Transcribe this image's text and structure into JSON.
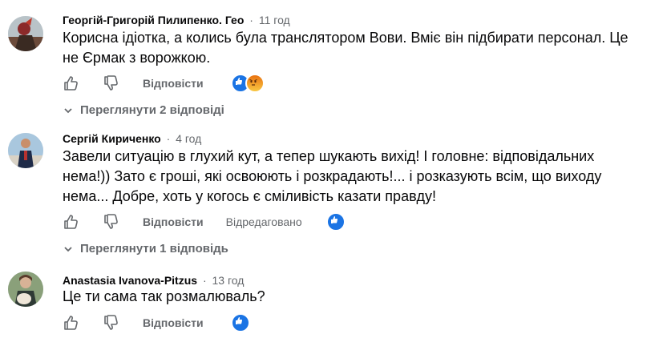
{
  "common": {
    "reply_label": "Відповісти",
    "like_icon": "thumbs-up-outline-icon",
    "dislike_icon": "thumbs-down-outline-icon",
    "accent": "#1b74e4",
    "muted": "#65686c"
  },
  "comments": [
    {
      "author": "Георгій-Григорій Пилипенко. Гео",
      "time": "11 год",
      "text_line1": "Корисна ідіотка, а колись була транслятором Вови. Вміє він підбирати персонал. Це",
      "text_line2": "не Єрмак з ворожкою.",
      "reactions": [
        "like",
        "angry"
      ],
      "replies_label": "Переглянути 2 відповіді"
    },
    {
      "author": "Сергій Кириченко",
      "time": "4 год",
      "text_line1": "Завели ситуацію в глухий кут, а тепер шукають вихід! І головне: відповідальних",
      "text_line2": "нема!)) Зато є гроші, які освоюють і розкрадають!... і розказують всім, що виходу",
      "text_line3": "нема... Добре, хоть у когось є сміливість казати правду!",
      "edited_label": "Відредаговано",
      "reactions": [
        "like"
      ],
      "replies_label": "Переглянути 1 відповідь"
    },
    {
      "author": "Anastasia Ivanova-Pitzus",
      "time": "13 год",
      "text_line1": "Це ти сама так розмалюваль?",
      "reactions": [
        "like"
      ]
    }
  ]
}
